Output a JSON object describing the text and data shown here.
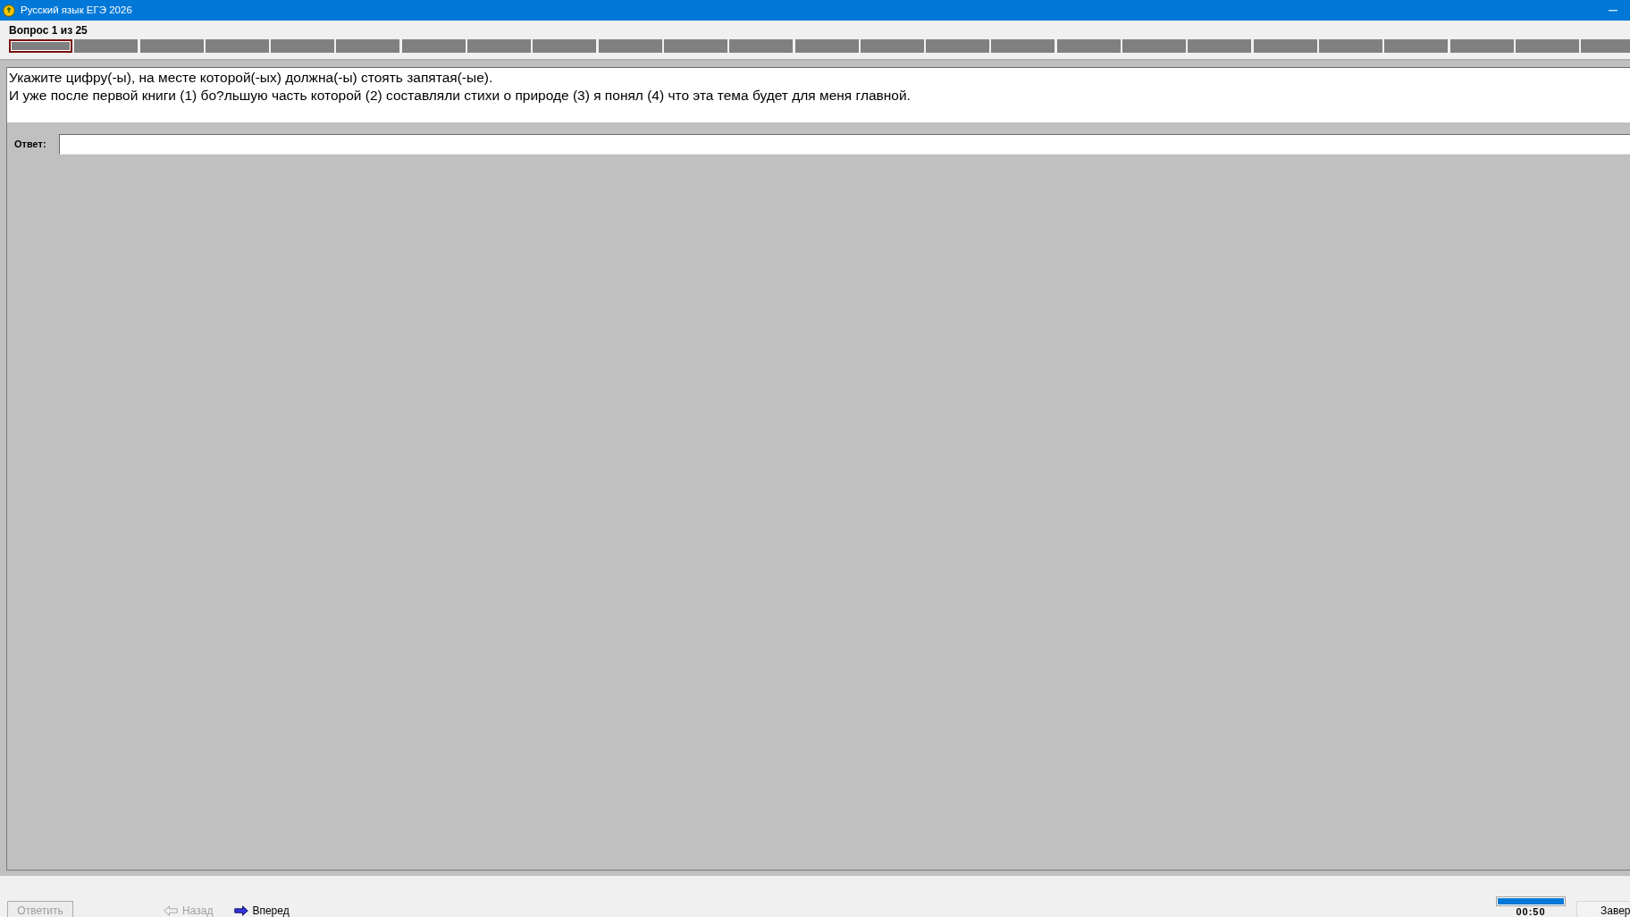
{
  "window": {
    "title": "Русский язык ЕГЭ 2026"
  },
  "question_counter": "Вопрос 1 из 25",
  "question_nav": [
    {
      "selected": true
    },
    {
      "selected": false
    },
    {
      "selected": false
    },
    {
      "selected": false
    },
    {
      "selected": false
    },
    {
      "selected": false
    },
    {
      "selected": false
    },
    {
      "selected": false
    },
    {
      "selected": false
    },
    {
      "selected": false
    },
    {
      "selected": false
    },
    {
      "selected": false
    },
    {
      "selected": false
    },
    {
      "selected": false
    },
    {
      "selected": false
    },
    {
      "selected": false
    },
    {
      "selected": false
    },
    {
      "selected": false
    },
    {
      "selected": false
    },
    {
      "selected": false
    },
    {
      "selected": false
    },
    {
      "selected": false
    },
    {
      "selected": false
    },
    {
      "selected": false
    },
    {
      "selected": false
    }
  ],
  "question": {
    "instruction": "Укажите цифру(-ы), на месте которой(-ых) должна(-ы) стоять запятая(-ые).",
    "sentence": "И уже после первой книги (1) бо?льшую часть которой (2) составляли стихи о природе (3) я понял (4) что эта тема будет для меня главной."
  },
  "answer": {
    "label": "Ответ:"
  },
  "footer": {
    "submit": {
      "label": "Ответить",
      "disabled": true
    },
    "back": {
      "label": "Назад",
      "disabled": true
    },
    "forward": {
      "label": "Вперед",
      "disabled": false
    }
  },
  "timer": {
    "level": 1,
    "time": "00:50"
  },
  "finish_button": {
    "label": "Завер"
  }
}
